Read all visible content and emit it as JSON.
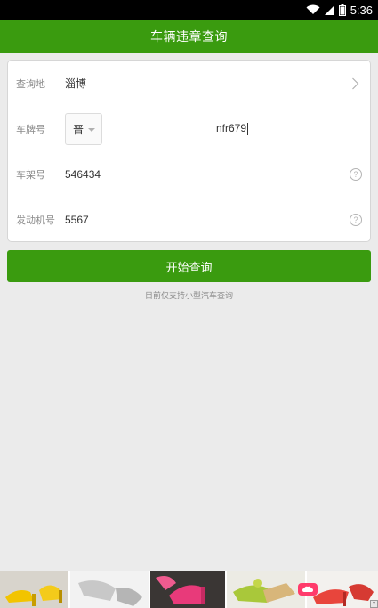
{
  "status_bar": {
    "time": "5:36",
    "icons": [
      "wifi-icon",
      "signal-icon",
      "battery-icon"
    ]
  },
  "app_bar": {
    "title": "车辆违章查询"
  },
  "form": {
    "city": {
      "label": "查询地",
      "value": "淄博"
    },
    "plate": {
      "label": "车牌号",
      "province": "晋",
      "number": "nfr679"
    },
    "frame": {
      "label": "车架号",
      "value": "546434",
      "help": "?"
    },
    "engine": {
      "label": "发动机号",
      "value": "5567",
      "help": "?"
    }
  },
  "submit": {
    "label": "开始查询"
  },
  "note": "目前仅支持小型汽车查询",
  "colors": {
    "primary": "#3a9b0f",
    "background": "#ebebeb",
    "ad_badge": "#ff3b6b"
  }
}
